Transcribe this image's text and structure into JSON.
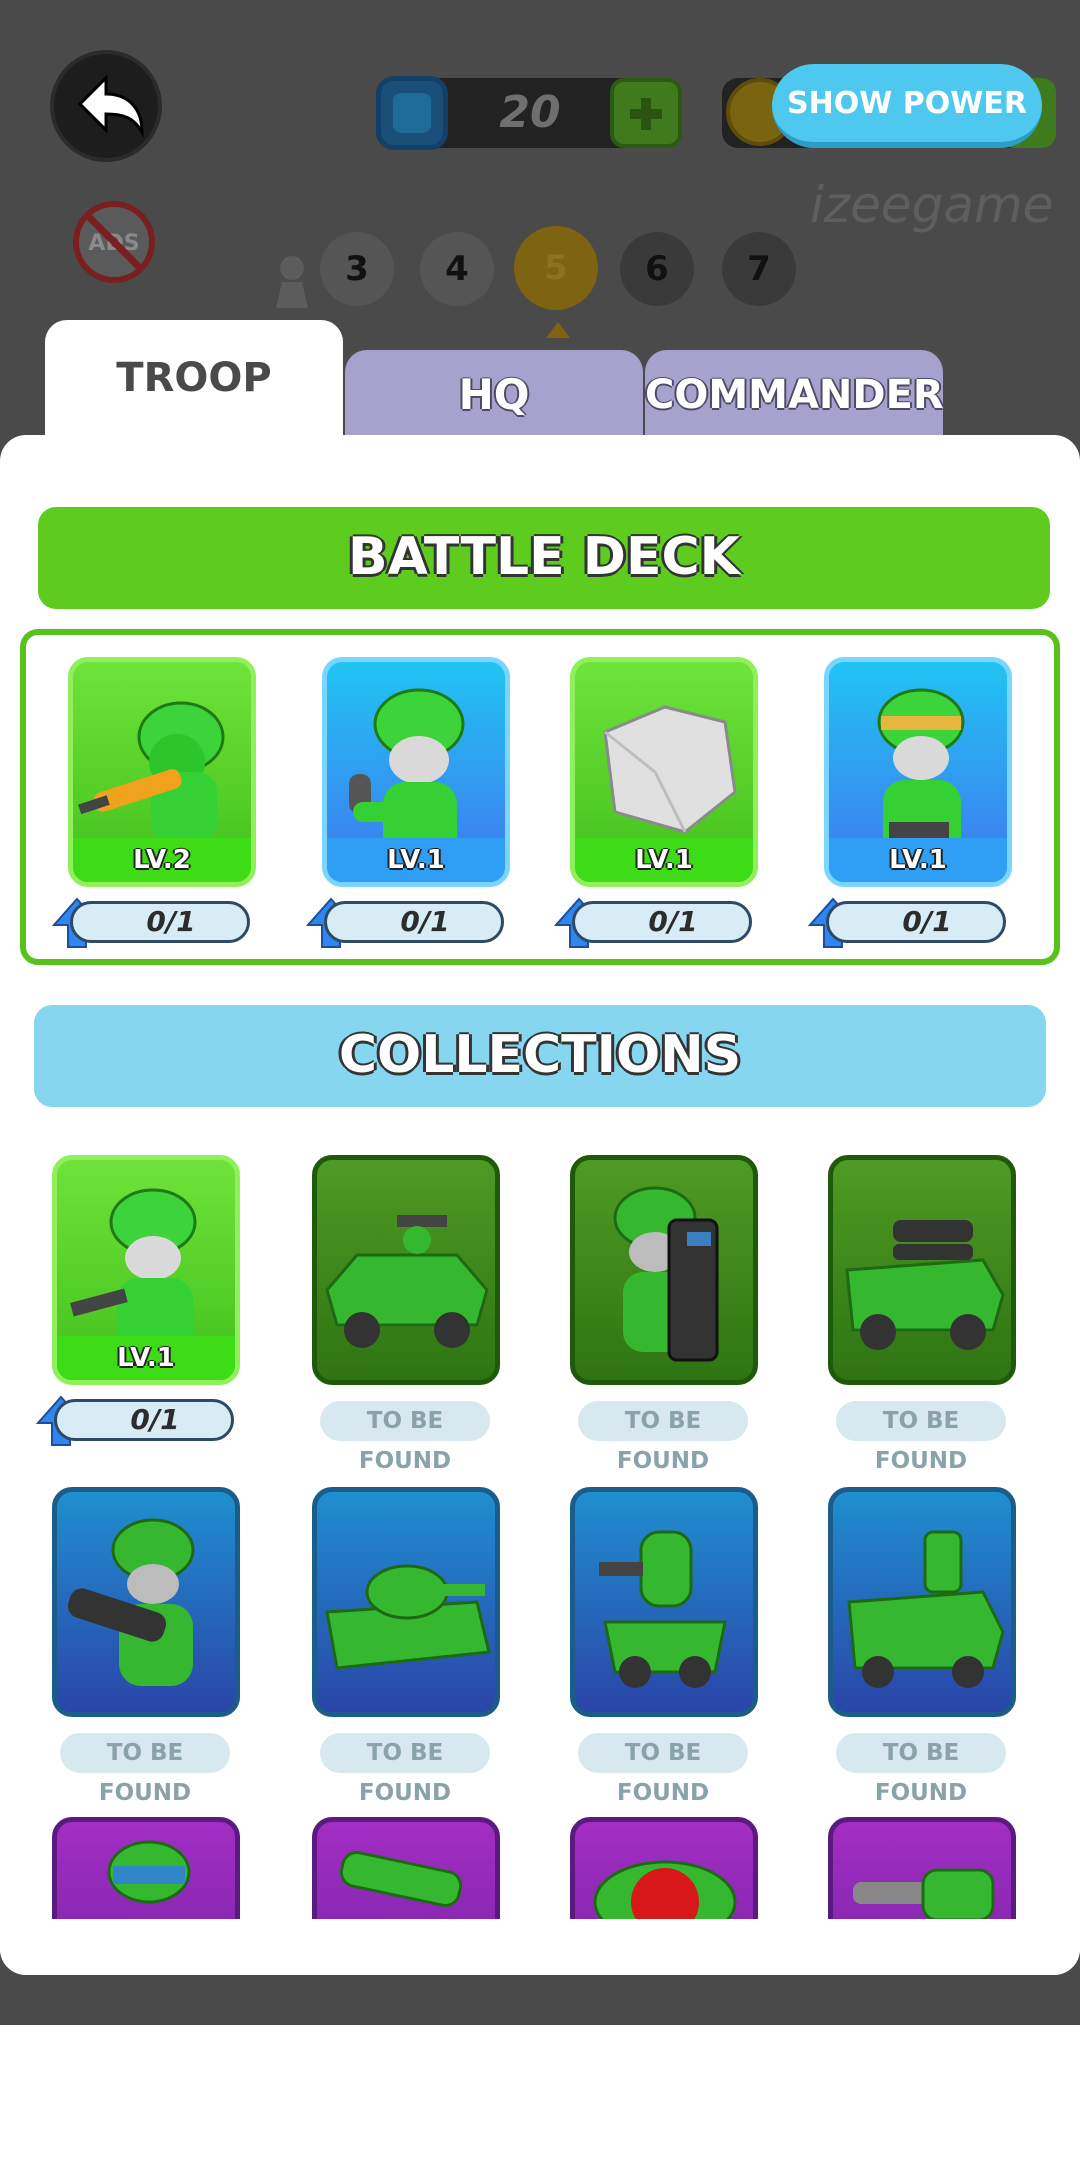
{
  "header": {
    "gems": "20",
    "show_power_label": "SHOW POWER",
    "watermark": "izeegame",
    "levels": [
      "3",
      "4",
      "5",
      "6",
      "7"
    ],
    "active_level": "5"
  },
  "tabs": [
    {
      "label": "TROOP",
      "active": true
    },
    {
      "label": "HQ",
      "active": false
    },
    {
      "label": "COMMANDER",
      "active": false
    }
  ],
  "battle_deck": {
    "title": "BATTLE DECK",
    "cards": [
      {
        "unit": "soldier-gunner",
        "level": "LV.2",
        "progress": "0/1",
        "style": "green"
      },
      {
        "unit": "soldier-thrower",
        "level": "LV.1",
        "progress": "0/1",
        "style": "blue"
      },
      {
        "unit": "rock",
        "level": "LV.1",
        "progress": "0/1",
        "style": "green"
      },
      {
        "unit": "soldier-headband",
        "level": "LV.1",
        "progress": "0/1",
        "style": "blue"
      }
    ]
  },
  "collections": {
    "title": "COLLECTIONS",
    "to_be_found_label": "TO BE FOUND",
    "rows": [
      [
        {
          "unit": "soldier-pistol",
          "level": "LV.1",
          "progress": "0/1",
          "style": "green"
        },
        {
          "unit": "jeep-gunner",
          "status": "TO BE FOUND",
          "style": "dkgreen"
        },
        {
          "unit": "shield-soldier",
          "status": "TO BE FOUND",
          "style": "dkgreen"
        },
        {
          "unit": "rocket-truck",
          "status": "TO BE FOUND",
          "style": "dkgreen"
        }
      ],
      [
        {
          "unit": "bazooka-soldier",
          "status": "TO BE FOUND",
          "style": "dkblue"
        },
        {
          "unit": "tank",
          "status": "TO BE FOUND",
          "style": "dkblue"
        },
        {
          "unit": "mech-robot",
          "status": "TO BE FOUND",
          "style": "dkblue"
        },
        {
          "unit": "armored-truck",
          "status": "TO BE FOUND",
          "style": "dkblue"
        }
      ],
      [
        {
          "unit": "helmet-soldier",
          "style": "purple"
        },
        {
          "unit": "cannon",
          "style": "purple"
        },
        {
          "unit": "red-dome-unit",
          "style": "purple"
        },
        {
          "unit": "gatling-unit",
          "style": "purple"
        }
      ]
    ]
  }
}
